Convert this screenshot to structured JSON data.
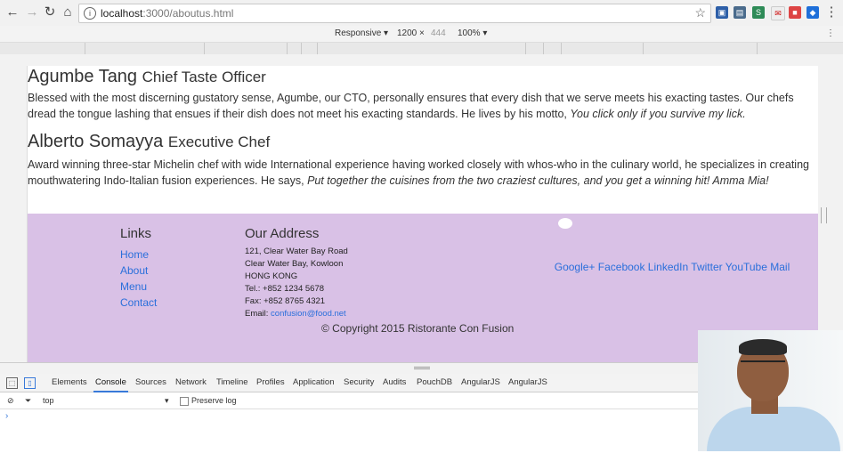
{
  "browser": {
    "url_host": "localhost",
    "url_path": ":3000/aboutus.html",
    "extensions": [
      "S",
      "✉",
      "◆"
    ]
  },
  "device_toolbar": {
    "mode": "Responsive",
    "width": "1200",
    "times": "×",
    "height": "444",
    "zoom": "100%"
  },
  "leaders": [
    {
      "name": "Agumbe Tang",
      "role": "Chief Taste Officer",
      "bio": "Blessed with the most discerning gustatory sense, Agumbe, our CTO, personally ensures that every dish that we serve meets his exacting tastes. Our chefs dread the tongue lashing that ensues if their dish does not meet his exacting standards. He lives by his motto, ",
      "quote": "You click only if you survive my lick."
    },
    {
      "name": "Alberto Somayya",
      "role": "Executive Chef",
      "bio": "Award winning three-star Michelin chef with wide International experience having worked closely with whos-who in the culinary world, he specializes in creating mouthwatering Indo-Italian fusion experiences. He says, ",
      "quote": "Put together the cuisines from the two craziest cultures, and you get a winning hit! Amma Mia!"
    }
  ],
  "footer": {
    "links_title": "Links",
    "links": [
      "Home",
      "About",
      "Menu",
      "Contact"
    ],
    "address_title": "Our Address",
    "address_lines": [
      "121, Clear Water Bay Road",
      "Clear Water Bay, Kowloon",
      "HONG KONG",
      "Tel.: +852 1234 5678",
      "Fax: +852 8765 4321"
    ],
    "email_label": "Email: ",
    "email": "confusion@food.net",
    "social": "Google+ Facebook LinkedIn Twitter YouTube Mail",
    "copyright": "© Copyright 2015 Ristorante Con Fusion"
  },
  "devtools": {
    "tabs": [
      "Elements",
      "Console",
      "Sources",
      "Network",
      "Timeline",
      "Profiles",
      "Application",
      "Security",
      "Audits",
      "PouchDB",
      "AngularJS",
      "AngularJS"
    ],
    "active_tab": "Console",
    "context": "top",
    "preserve_log": "Preserve log",
    "prompt": "›"
  },
  "colors": {
    "footer_bg": "#d9c1e6",
    "link": "#2a6fdb",
    "devtools_accent": "#3879d9"
  }
}
